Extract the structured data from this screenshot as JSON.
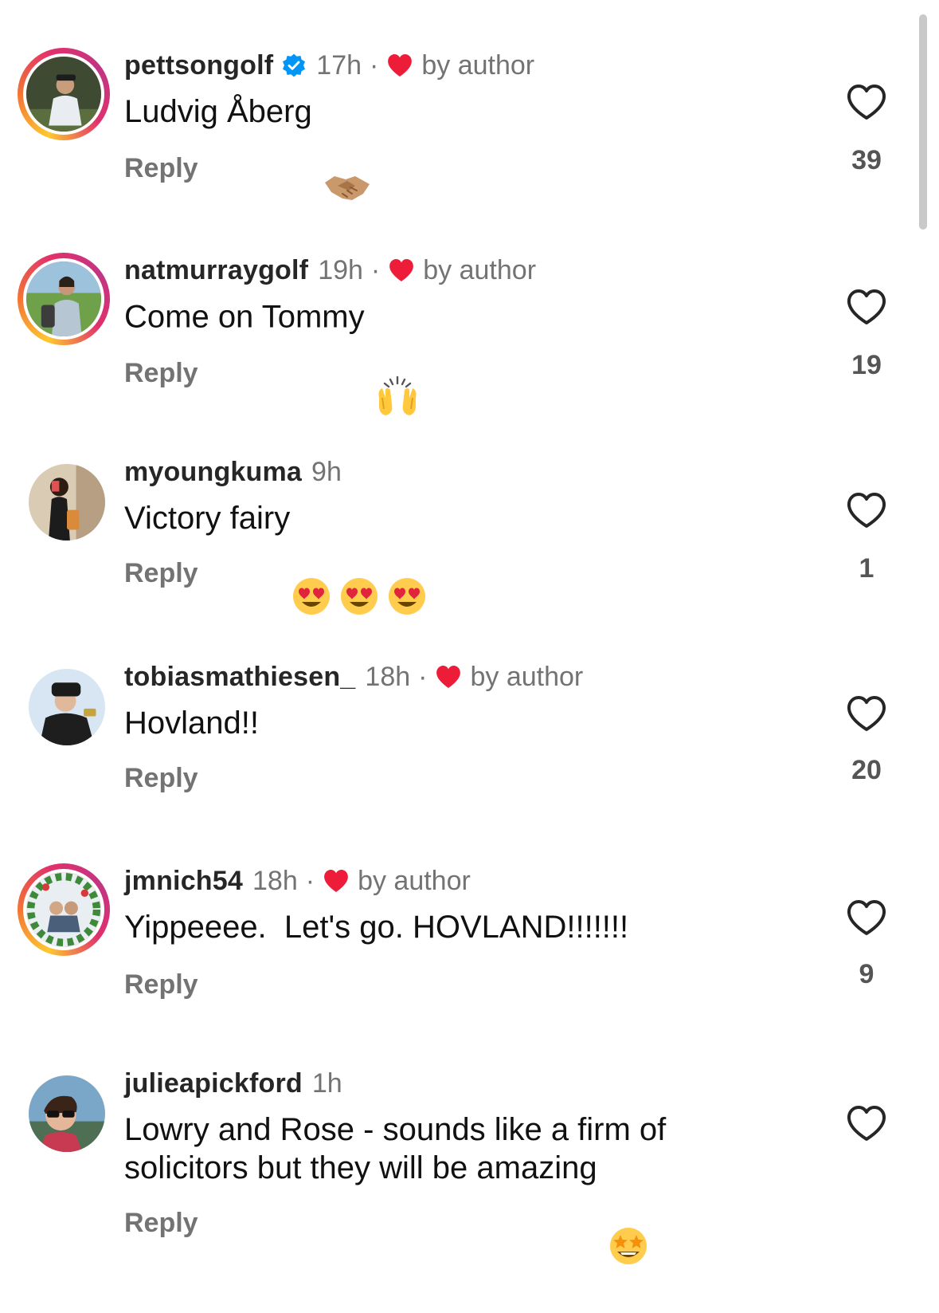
{
  "colors": {
    "text_primary": "#111111",
    "username": "#262626",
    "secondary": "#737373",
    "heart_red": "#ed1d3a",
    "verified_blue": "#0095f6"
  },
  "labels": {
    "reply": "Reply",
    "by_author": "by author",
    "separator": "·"
  },
  "comments": [
    {
      "username": "pettsongolf",
      "verified": true,
      "time": "17h",
      "liked_by_author": true,
      "text": "Ludvig Åberg",
      "emoji": [
        "handshake"
      ],
      "likes": "39",
      "story_ring": true
    },
    {
      "username": "natmurraygolf",
      "verified": false,
      "time": "19h",
      "liked_by_author": true,
      "text": "Come on Tommy",
      "emoji": [
        "raising-hands"
      ],
      "likes": "19",
      "story_ring": true
    },
    {
      "username": "myoungkuma",
      "verified": false,
      "time": "9h",
      "liked_by_author": false,
      "text": "Victory fairy",
      "emoji": [
        "heart-eyes",
        "heart-eyes",
        "heart-eyes"
      ],
      "likes": "1",
      "story_ring": false
    },
    {
      "username": "tobiasmathiesen_",
      "verified": false,
      "time": "18h",
      "liked_by_author": true,
      "text": "Hovland!!",
      "emoji": [],
      "likes": "20",
      "story_ring": false
    },
    {
      "username": "jmnich54",
      "verified": false,
      "time": "18h",
      "liked_by_author": true,
      "text": "Yippeeee.  Let's go. HOVLAND!!!!!!!",
      "emoji": [],
      "likes": "9",
      "story_ring": true
    },
    {
      "username": "julieapickford",
      "verified": false,
      "time": "1h",
      "liked_by_author": false,
      "text": "Lowry and Rose - sounds like a firm of solicitors but they will be amazing",
      "emoji": [
        "star-struck"
      ],
      "likes": "",
      "story_ring": false
    }
  ]
}
